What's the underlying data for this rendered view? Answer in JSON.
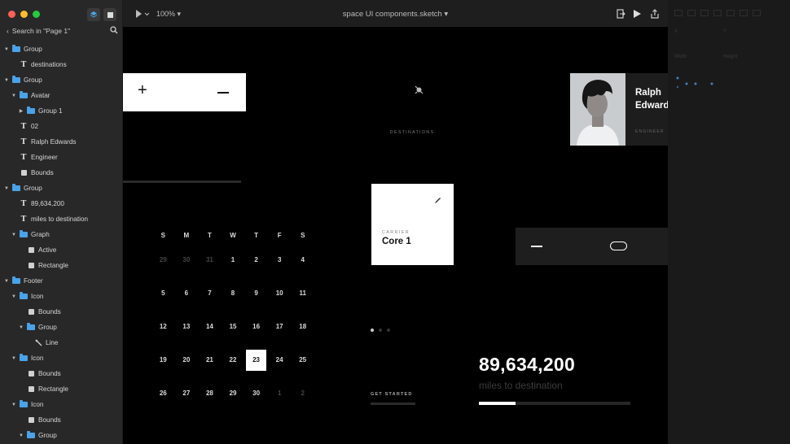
{
  "sidebar": {
    "search_label": "Search in \"Page 1\"",
    "layers": [
      {
        "label": "Group",
        "type": "folder",
        "depth": 1,
        "expanded": true
      },
      {
        "label": "destinations",
        "type": "text",
        "depth": 2
      },
      {
        "label": "Group",
        "type": "folder",
        "depth": 1,
        "expanded": true
      },
      {
        "label": "Avatar",
        "type": "folder",
        "depth": 2,
        "expanded": true
      },
      {
        "label": "Group 1",
        "type": "folder",
        "depth": 3,
        "expanded": false
      },
      {
        "label": "02",
        "type": "text",
        "depth": 2
      },
      {
        "label": "Ralph Edwards",
        "type": "text",
        "depth": 2
      },
      {
        "label": "Engineer",
        "type": "text",
        "depth": 2
      },
      {
        "label": "Bounds",
        "type": "shape",
        "depth": 2
      },
      {
        "label": "Group",
        "type": "folder",
        "depth": 1,
        "expanded": true
      },
      {
        "label": "89,634,200",
        "type": "text",
        "depth": 2
      },
      {
        "label": "miles to destination",
        "type": "text",
        "depth": 2
      },
      {
        "label": "Graph",
        "type": "folder",
        "depth": 2,
        "expanded": true
      },
      {
        "label": "Active",
        "type": "shape",
        "depth": 3
      },
      {
        "label": "Rectangle",
        "type": "shape",
        "depth": 3
      },
      {
        "label": "Footer",
        "type": "folder",
        "depth": 1,
        "expanded": true
      },
      {
        "label": "Icon",
        "type": "folder",
        "depth": 2,
        "expanded": true
      },
      {
        "label": "Bounds",
        "type": "shape",
        "depth": 3
      },
      {
        "label": "Group",
        "type": "folder",
        "depth": 3,
        "expanded": true
      },
      {
        "label": "Line",
        "type": "line",
        "depth": 4
      },
      {
        "label": "Icon",
        "type": "folder",
        "depth": 2,
        "expanded": true
      },
      {
        "label": "Bounds",
        "type": "shape",
        "depth": 3
      },
      {
        "label": "Rectangle",
        "type": "shape",
        "depth": 3
      },
      {
        "label": "Icon",
        "type": "folder",
        "depth": 2,
        "expanded": true
      },
      {
        "label": "Bounds",
        "type": "shape",
        "depth": 3
      },
      {
        "label": "Group",
        "type": "folder",
        "depth": 3,
        "expanded": true
      }
    ]
  },
  "toolbar": {
    "zoom": "100%",
    "document_title": "space UI components.sketch"
  },
  "inspector": {
    "x_label": "X",
    "y_label": "Y",
    "width_label": "Width",
    "height_label": "Height"
  },
  "canvas": {
    "destinations_label": "DESTINATIONS",
    "calendar": {
      "weekdays": [
        "S",
        "M",
        "T",
        "W",
        "T",
        "F",
        "S"
      ],
      "weeks": [
        [
          "29",
          "30",
          "31",
          "1",
          "2",
          "3",
          "4"
        ],
        [
          "5",
          "6",
          "7",
          "8",
          "9",
          "10",
          "11"
        ],
        [
          "12",
          "13",
          "14",
          "15",
          "16",
          "17",
          "18"
        ],
        [
          "19",
          "20",
          "21",
          "22",
          "23",
          "24",
          "25"
        ],
        [
          "26",
          "27",
          "28",
          "29",
          "30",
          "1",
          "2"
        ]
      ],
      "selected_day": "23"
    },
    "carrier": {
      "label": "CARRIER",
      "name": "Core 1"
    },
    "profile": {
      "name_line1": "Ralph",
      "name_line2": "Edwards",
      "role": "ENGINEER"
    },
    "get_started": "GET STARTED",
    "stat": {
      "value": "89,634,200",
      "caption": "miles to destination",
      "progress": 0.24
    },
    "carousel": {
      "count": 3,
      "active": 0
    }
  }
}
